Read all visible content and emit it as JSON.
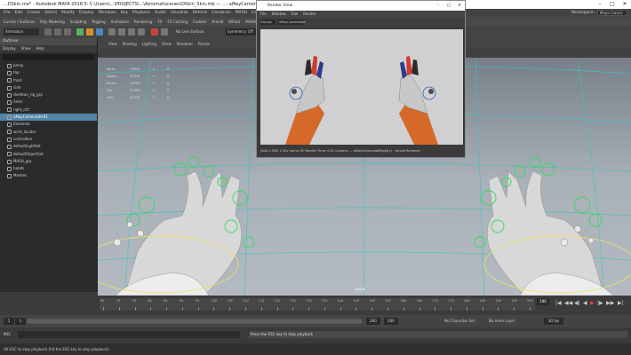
{
  "window": {
    "title": "...DSkin.ma* - Autodesk MAYA 2018.5: C:\\Users\\...\\PROJECTS\\...\\Aeromal\\scenes\\DSkin_Skin.mb — ...: aMayCameraIdleRight"
  },
  "menubar": {
    "items": [
      "File",
      "Edit",
      "Create",
      "Select",
      "Modify",
      "Display",
      "Windows",
      "Key",
      "Playback",
      "Audio",
      "Visualize",
      "Deform",
      "Constrain",
      "MASH",
      "Cache",
      "Arnold",
      "Help"
    ],
    "workspace_label": "Workspace:",
    "workspace_value": "Maya Classic"
  },
  "shelf": {
    "tabs": [
      "Curves / Surfaces",
      "Poly Modeling",
      "Sculpting",
      "Rigging",
      "Animation",
      "Rendering",
      "FX",
      "FX Caching",
      "Custom",
      "Arnold",
      "Bifrost",
      "MASH",
      "Motion Graphics",
      "XGen",
      "TURTLE"
    ],
    "mode_select": "Animation",
    "live_label": "No Live Surface",
    "search_placeholder": "Symmetry: Off"
  },
  "outliner": {
    "title": "Outliner",
    "menus": [
      "Display",
      "Show",
      "Help"
    ],
    "rows": [
      {
        "label": "persp",
        "selected": false
      },
      {
        "label": "top",
        "selected": false
      },
      {
        "label": "front",
        "selected": false
      },
      {
        "label": "side",
        "selected": false
      },
      {
        "label": "skeleton_rig_grp",
        "selected": false
      },
      {
        "label": "Arms",
        "selected": false
      },
      {
        "label": "right_ctrl",
        "selected": false
      },
      {
        "label": "aMayCameraIdleR1",
        "selected": true
      },
      {
        "label": "Elements",
        "selected": false
      },
      {
        "label": "wrist_locator",
        "selected": false
      },
      {
        "label": "controllers",
        "selected": false
      },
      {
        "label": "defaultLightSet",
        "selected": false
      },
      {
        "label": "defaultObjectSet",
        "selected": false
      },
      {
        "label": "MASH_grp",
        "selected": false
      },
      {
        "label": "hands",
        "selected": false
      },
      {
        "label": "Meshes",
        "selected": false
      }
    ]
  },
  "viewport": {
    "menus": [
      "View",
      "Shading",
      "Lighting",
      "Show",
      "Renderer",
      "Panels"
    ],
    "hud": [
      {
        "label": "Verts:",
        "a": "18654",
        "b": "0",
        "c": "0"
      },
      {
        "label": "Edges:",
        "a": "37510",
        "b": "0",
        "c": "0"
      },
      {
        "label": "Faces:",
        "a": "18750",
        "b": "0",
        "c": "0"
      },
      {
        "label": "Tris:",
        "a": "37300",
        "b": "0",
        "c": "0"
      },
      {
        "label": "UVs:",
        "a": "22015",
        "b": "0",
        "c": "0"
      }
    ],
    "camera_label": "persp"
  },
  "render_window": {
    "title": "Render View",
    "menus": [
      "File",
      "Window",
      "Tool",
      "Render"
    ],
    "dropdown_a": "Display",
    "dropdown_b": "aMayCameraIdle",
    "status": "(640 x 360) 1.00x  frame: 60  Render Time: 0:02  Camera: ... aMayCameraIdleRight(1) · Arnold Renderer"
  },
  "timeline": {
    "ticks": [
      "65",
      "70",
      "75",
      "80",
      "85",
      "90",
      "95",
      "100",
      "105",
      "110",
      "115",
      "120",
      "125",
      "130",
      "135",
      "140",
      "145",
      "150",
      "155",
      "160",
      "165",
      "170",
      "175",
      "180",
      "185",
      "190",
      "195",
      "200"
    ],
    "current_frame": "190",
    "playback_icons": [
      "|◀",
      "◀◀",
      "◀|",
      "◀",
      "▶",
      "|▶",
      "▶▶",
      "▶|"
    ]
  },
  "range": {
    "start": "1",
    "end": "200",
    "range_start": "200",
    "range_end": "200",
    "character_set_label": "No Character Set",
    "anim_layer_label": "No Anim Layer",
    "fps": "30 fps"
  },
  "command": {
    "mel_label": "MEL",
    "result": "Press the ESC key to stop playback"
  },
  "helpline": {
    "text": "Hit ESC to stop playback (hit the ESC key to stop playback)."
  },
  "colors": {
    "selected_row": "#5285a6",
    "ik_handle": "#2fdc5a",
    "grid": "#36c7c0",
    "joint": "#a9d4ff"
  }
}
